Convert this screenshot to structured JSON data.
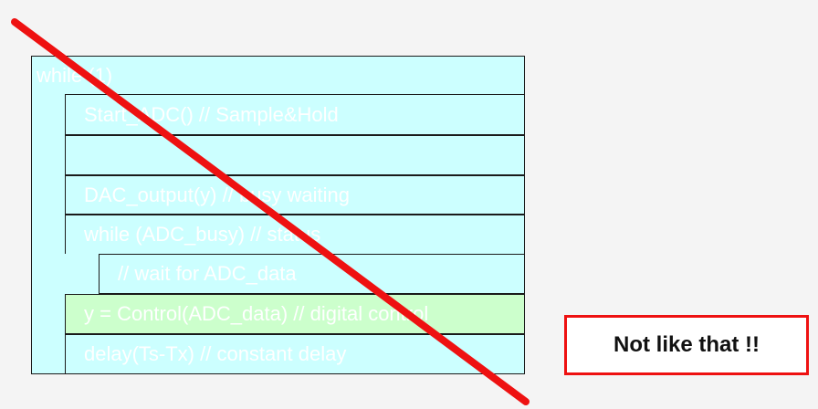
{
  "diagram": {
    "loop_header": "while (1)",
    "rows": [
      "Start_ADC()   // Sample&Hold",
      "",
      "DAC_output(y)    // busy waiting",
      "while (ADC_busy)   // status",
      "// wait for ADC_data",
      "y = Control(ADC_data)   // digital control",
      "delay(Ts-Tx)   // constant delay"
    ],
    "colors": {
      "block": "#ccffff",
      "highlight": "#ccffcc",
      "cross": "#ee1111",
      "border": "#1a1a1a"
    }
  },
  "note": {
    "text": "Not like that !!"
  }
}
